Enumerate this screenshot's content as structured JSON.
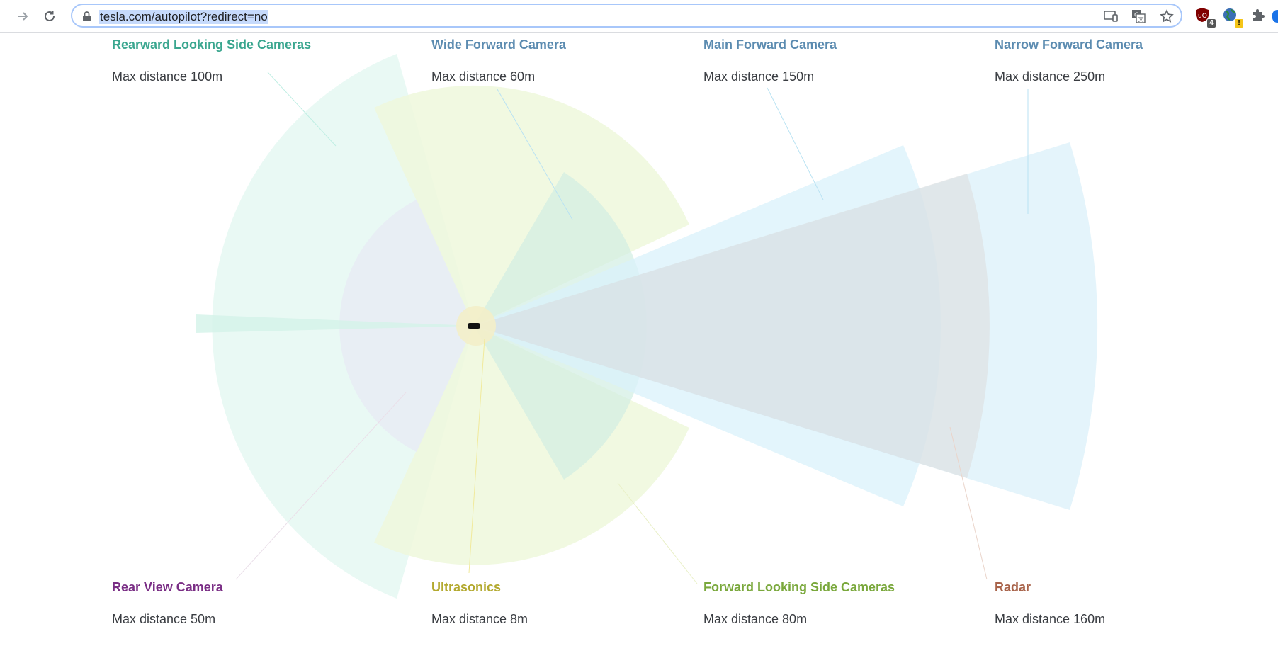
{
  "browser": {
    "url": "tesla.com/autopilot?redirect=no",
    "extensions": [
      {
        "name": "ublock-icon",
        "badge": "4",
        "color": "#800000"
      },
      {
        "name": "globe-extension-icon",
        "badge": "!",
        "color": "#f5c518"
      }
    ]
  },
  "colors": {
    "rearward_side": "#3aa68f",
    "wide_forward": "#5b8bb0",
    "main_forward": "#5b8bb0",
    "narrow_forward": "#5b8bb0",
    "rear_view": "#7a2e85",
    "ultrasonics": "#b3a92f",
    "forward_side": "#7aa83c",
    "radar": "#a8634a"
  },
  "labels": {
    "rearward_side": {
      "title": "Rearward Looking Side Cameras",
      "sub": "Max distance 100m"
    },
    "wide_forward": {
      "title": "Wide Forward Camera",
      "sub": "Max distance 60m"
    },
    "main_forward": {
      "title": "Main Forward Camera",
      "sub": "Max distance 150m"
    },
    "narrow_forward": {
      "title": "Narrow Forward Camera",
      "sub": "Max distance 250m"
    },
    "rear_view": {
      "title": "Rear View Camera",
      "sub": "Max distance 50m"
    },
    "ultrasonics": {
      "title": "Ultrasonics",
      "sub": "Max distance 8m"
    },
    "forward_side": {
      "title": "Forward Looking Side Cameras",
      "sub": "Max distance 80m"
    },
    "radar": {
      "title": "Radar",
      "sub": "Max distance 160m"
    }
  }
}
